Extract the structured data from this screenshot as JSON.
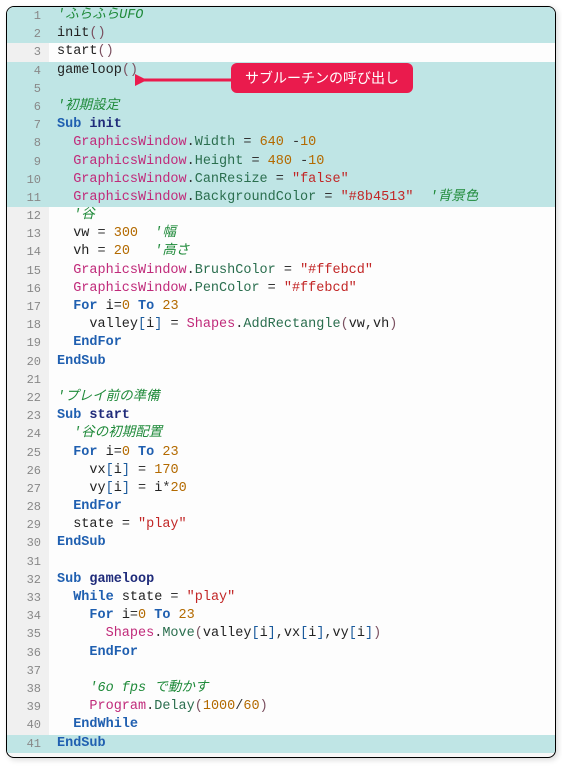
{
  "callout": "サブルーチンの呼び出し",
  "lines": [
    {
      "n": 1,
      "hl": true,
      "tokens": [
        [
          "comment",
          "'ふらふらUFO"
        ]
      ]
    },
    {
      "n": 2,
      "hl": true,
      "tokens": [
        [
          "call",
          "init"
        ],
        [
          "paren",
          "()"
        ]
      ]
    },
    {
      "n": 3,
      "hl": false,
      "tokens": [
        [
          "call",
          "start"
        ],
        [
          "paren",
          "()"
        ]
      ]
    },
    {
      "n": 4,
      "hl": true,
      "tokens": [
        [
          "call",
          "gameloop"
        ],
        [
          "paren",
          "()"
        ]
      ]
    },
    {
      "n": 5,
      "hl": true,
      "tokens": []
    },
    {
      "n": 6,
      "hl": true,
      "tokens": [
        [
          "comment",
          "'初期設定"
        ]
      ]
    },
    {
      "n": 7,
      "hl": true,
      "tokens": [
        [
          "keyword",
          "Sub "
        ],
        [
          "ident",
          "init"
        ]
      ]
    },
    {
      "n": 8,
      "hl": true,
      "tokens": [
        [
          "plain",
          "  "
        ],
        [
          "obj",
          "GraphicsWindow"
        ],
        [
          "op",
          "."
        ],
        [
          "prop",
          "Width"
        ],
        [
          "op",
          " = "
        ],
        [
          "num",
          "640"
        ],
        [
          "op",
          " -"
        ],
        [
          "num",
          "10"
        ]
      ]
    },
    {
      "n": 9,
      "hl": true,
      "tokens": [
        [
          "plain",
          "  "
        ],
        [
          "obj",
          "GraphicsWindow"
        ],
        [
          "op",
          "."
        ],
        [
          "prop",
          "Height"
        ],
        [
          "op",
          " = "
        ],
        [
          "num",
          "480"
        ],
        [
          "op",
          " -"
        ],
        [
          "num",
          "10"
        ]
      ]
    },
    {
      "n": 10,
      "hl": true,
      "tokens": [
        [
          "plain",
          "  "
        ],
        [
          "obj",
          "GraphicsWindow"
        ],
        [
          "op",
          "."
        ],
        [
          "prop",
          "CanResize"
        ],
        [
          "op",
          " = "
        ],
        [
          "str",
          "\"false\""
        ]
      ]
    },
    {
      "n": 11,
      "hl": true,
      "tokens": [
        [
          "plain",
          "  "
        ],
        [
          "obj",
          "GraphicsWindow"
        ],
        [
          "op",
          "."
        ],
        [
          "prop",
          "BackgroundColor"
        ],
        [
          "op",
          " = "
        ],
        [
          "str",
          "\"#8b4513\""
        ],
        [
          "plain",
          "  "
        ],
        [
          "comment",
          "'背景色"
        ]
      ]
    },
    {
      "n": 12,
      "hl": false,
      "tokens": [
        [
          "plain",
          "  "
        ],
        [
          "comment",
          "'谷"
        ]
      ]
    },
    {
      "n": 13,
      "hl": false,
      "tokens": [
        [
          "plain",
          "  "
        ],
        [
          "var",
          "vw"
        ],
        [
          "op",
          " = "
        ],
        [
          "num",
          "300"
        ],
        [
          "plain",
          "  "
        ],
        [
          "comment",
          "'幅"
        ]
      ]
    },
    {
      "n": 14,
      "hl": false,
      "tokens": [
        [
          "plain",
          "  "
        ],
        [
          "var",
          "vh"
        ],
        [
          "op",
          " = "
        ],
        [
          "num",
          "20"
        ],
        [
          "plain",
          "   "
        ],
        [
          "comment",
          "'高さ"
        ]
      ]
    },
    {
      "n": 15,
      "hl": false,
      "tokens": [
        [
          "plain",
          "  "
        ],
        [
          "obj",
          "GraphicsWindow"
        ],
        [
          "op",
          "."
        ],
        [
          "prop",
          "BrushColor"
        ],
        [
          "op",
          " = "
        ],
        [
          "str",
          "\"#ffebcd\""
        ]
      ]
    },
    {
      "n": 16,
      "hl": false,
      "tokens": [
        [
          "plain",
          "  "
        ],
        [
          "obj",
          "GraphicsWindow"
        ],
        [
          "op",
          "."
        ],
        [
          "prop",
          "PenColor"
        ],
        [
          "op",
          " = "
        ],
        [
          "str",
          "\"#ffebcd\""
        ]
      ]
    },
    {
      "n": 17,
      "hl": false,
      "tokens": [
        [
          "plain",
          "  "
        ],
        [
          "keyword2",
          "For "
        ],
        [
          "var",
          "i"
        ],
        [
          "op",
          "="
        ],
        [
          "num",
          "0"
        ],
        [
          "keyword2",
          " To "
        ],
        [
          "num",
          "23"
        ]
      ]
    },
    {
      "n": 18,
      "hl": false,
      "tokens": [
        [
          "plain",
          "    "
        ],
        [
          "var",
          "valley"
        ],
        [
          "bracket",
          "["
        ],
        [
          "var",
          "i"
        ],
        [
          "bracket",
          "]"
        ],
        [
          "op",
          " = "
        ],
        [
          "obj",
          "Shapes"
        ],
        [
          "op",
          "."
        ],
        [
          "prop",
          "AddRectangle"
        ],
        [
          "paren",
          "("
        ],
        [
          "var",
          "vw"
        ],
        [
          "op",
          ","
        ],
        [
          "var",
          "vh"
        ],
        [
          "paren",
          ")"
        ]
      ]
    },
    {
      "n": 19,
      "hl": false,
      "tokens": [
        [
          "plain",
          "  "
        ],
        [
          "keyword2",
          "EndFor"
        ]
      ]
    },
    {
      "n": 20,
      "hl": false,
      "tokens": [
        [
          "keyword",
          "EndSub"
        ]
      ]
    },
    {
      "n": 21,
      "hl": false,
      "tokens": []
    },
    {
      "n": 22,
      "hl": false,
      "tokens": [
        [
          "comment",
          "'プレイ前の準備"
        ]
      ]
    },
    {
      "n": 23,
      "hl": false,
      "tokens": [
        [
          "keyword",
          "Sub "
        ],
        [
          "ident",
          "start"
        ]
      ]
    },
    {
      "n": 24,
      "hl": false,
      "tokens": [
        [
          "plain",
          "  "
        ],
        [
          "comment",
          "'谷の初期配置"
        ]
      ]
    },
    {
      "n": 25,
      "hl": false,
      "tokens": [
        [
          "plain",
          "  "
        ],
        [
          "keyword2",
          "For "
        ],
        [
          "var",
          "i"
        ],
        [
          "op",
          "="
        ],
        [
          "num",
          "0"
        ],
        [
          "keyword2",
          " To "
        ],
        [
          "num",
          "23"
        ]
      ]
    },
    {
      "n": 26,
      "hl": false,
      "tokens": [
        [
          "plain",
          "    "
        ],
        [
          "var",
          "vx"
        ],
        [
          "bracket",
          "["
        ],
        [
          "var",
          "i"
        ],
        [
          "bracket",
          "]"
        ],
        [
          "op",
          " = "
        ],
        [
          "num",
          "170"
        ]
      ]
    },
    {
      "n": 27,
      "hl": false,
      "tokens": [
        [
          "plain",
          "    "
        ],
        [
          "var",
          "vy"
        ],
        [
          "bracket",
          "["
        ],
        [
          "var",
          "i"
        ],
        [
          "bracket",
          "]"
        ],
        [
          "op",
          " = "
        ],
        [
          "var",
          "i"
        ],
        [
          "op",
          "*"
        ],
        [
          "num",
          "20"
        ]
      ]
    },
    {
      "n": 28,
      "hl": false,
      "tokens": [
        [
          "plain",
          "  "
        ],
        [
          "keyword2",
          "EndFor"
        ]
      ]
    },
    {
      "n": 29,
      "hl": false,
      "tokens": [
        [
          "plain",
          "  "
        ],
        [
          "var",
          "state"
        ],
        [
          "op",
          " = "
        ],
        [
          "str",
          "\"play\""
        ]
      ]
    },
    {
      "n": 30,
      "hl": false,
      "tokens": [
        [
          "keyword",
          "EndSub"
        ]
      ]
    },
    {
      "n": 31,
      "hl": false,
      "tokens": []
    },
    {
      "n": 32,
      "hl": false,
      "tokens": [
        [
          "keyword",
          "Sub "
        ],
        [
          "ident",
          "gameloop"
        ]
      ]
    },
    {
      "n": 33,
      "hl": false,
      "tokens": [
        [
          "plain",
          "  "
        ],
        [
          "keyword2",
          "While "
        ],
        [
          "var",
          "state"
        ],
        [
          "op",
          " = "
        ],
        [
          "str",
          "\"play\""
        ]
      ]
    },
    {
      "n": 34,
      "hl": false,
      "tokens": [
        [
          "plain",
          "    "
        ],
        [
          "keyword2",
          "For "
        ],
        [
          "var",
          "i"
        ],
        [
          "op",
          "="
        ],
        [
          "num",
          "0"
        ],
        [
          "keyword2",
          " To "
        ],
        [
          "num",
          "23"
        ]
      ]
    },
    {
      "n": 35,
      "hl": false,
      "tokens": [
        [
          "plain",
          "      "
        ],
        [
          "obj",
          "Shapes"
        ],
        [
          "op",
          "."
        ],
        [
          "prop",
          "Move"
        ],
        [
          "paren",
          "("
        ],
        [
          "var",
          "valley"
        ],
        [
          "bracket",
          "["
        ],
        [
          "var",
          "i"
        ],
        [
          "bracket",
          "]"
        ],
        [
          "op",
          ","
        ],
        [
          "var",
          "vx"
        ],
        [
          "bracket",
          "["
        ],
        [
          "var",
          "i"
        ],
        [
          "bracket",
          "]"
        ],
        [
          "op",
          ","
        ],
        [
          "var",
          "vy"
        ],
        [
          "bracket",
          "["
        ],
        [
          "var",
          "i"
        ],
        [
          "bracket",
          "]"
        ],
        [
          "paren",
          ")"
        ]
      ]
    },
    {
      "n": 36,
      "hl": false,
      "tokens": [
        [
          "plain",
          "    "
        ],
        [
          "keyword2",
          "EndFor"
        ]
      ]
    },
    {
      "n": 37,
      "hl": false,
      "tokens": []
    },
    {
      "n": 38,
      "hl": false,
      "tokens": [
        [
          "plain",
          "    "
        ],
        [
          "comment",
          "'6o fps で動かす"
        ]
      ]
    },
    {
      "n": 39,
      "hl": false,
      "tokens": [
        [
          "plain",
          "    "
        ],
        [
          "obj",
          "Program"
        ],
        [
          "op",
          "."
        ],
        [
          "prop",
          "Delay"
        ],
        [
          "paren",
          "("
        ],
        [
          "num",
          "1000"
        ],
        [
          "op",
          "/"
        ],
        [
          "num",
          "60"
        ],
        [
          "paren",
          ")"
        ]
      ]
    },
    {
      "n": 40,
      "hl": false,
      "tokens": [
        [
          "plain",
          "  "
        ],
        [
          "keyword2",
          "EndWhile"
        ]
      ]
    },
    {
      "n": 41,
      "hl": true,
      "tokens": [
        [
          "keyword",
          "EndSub"
        ]
      ]
    }
  ]
}
